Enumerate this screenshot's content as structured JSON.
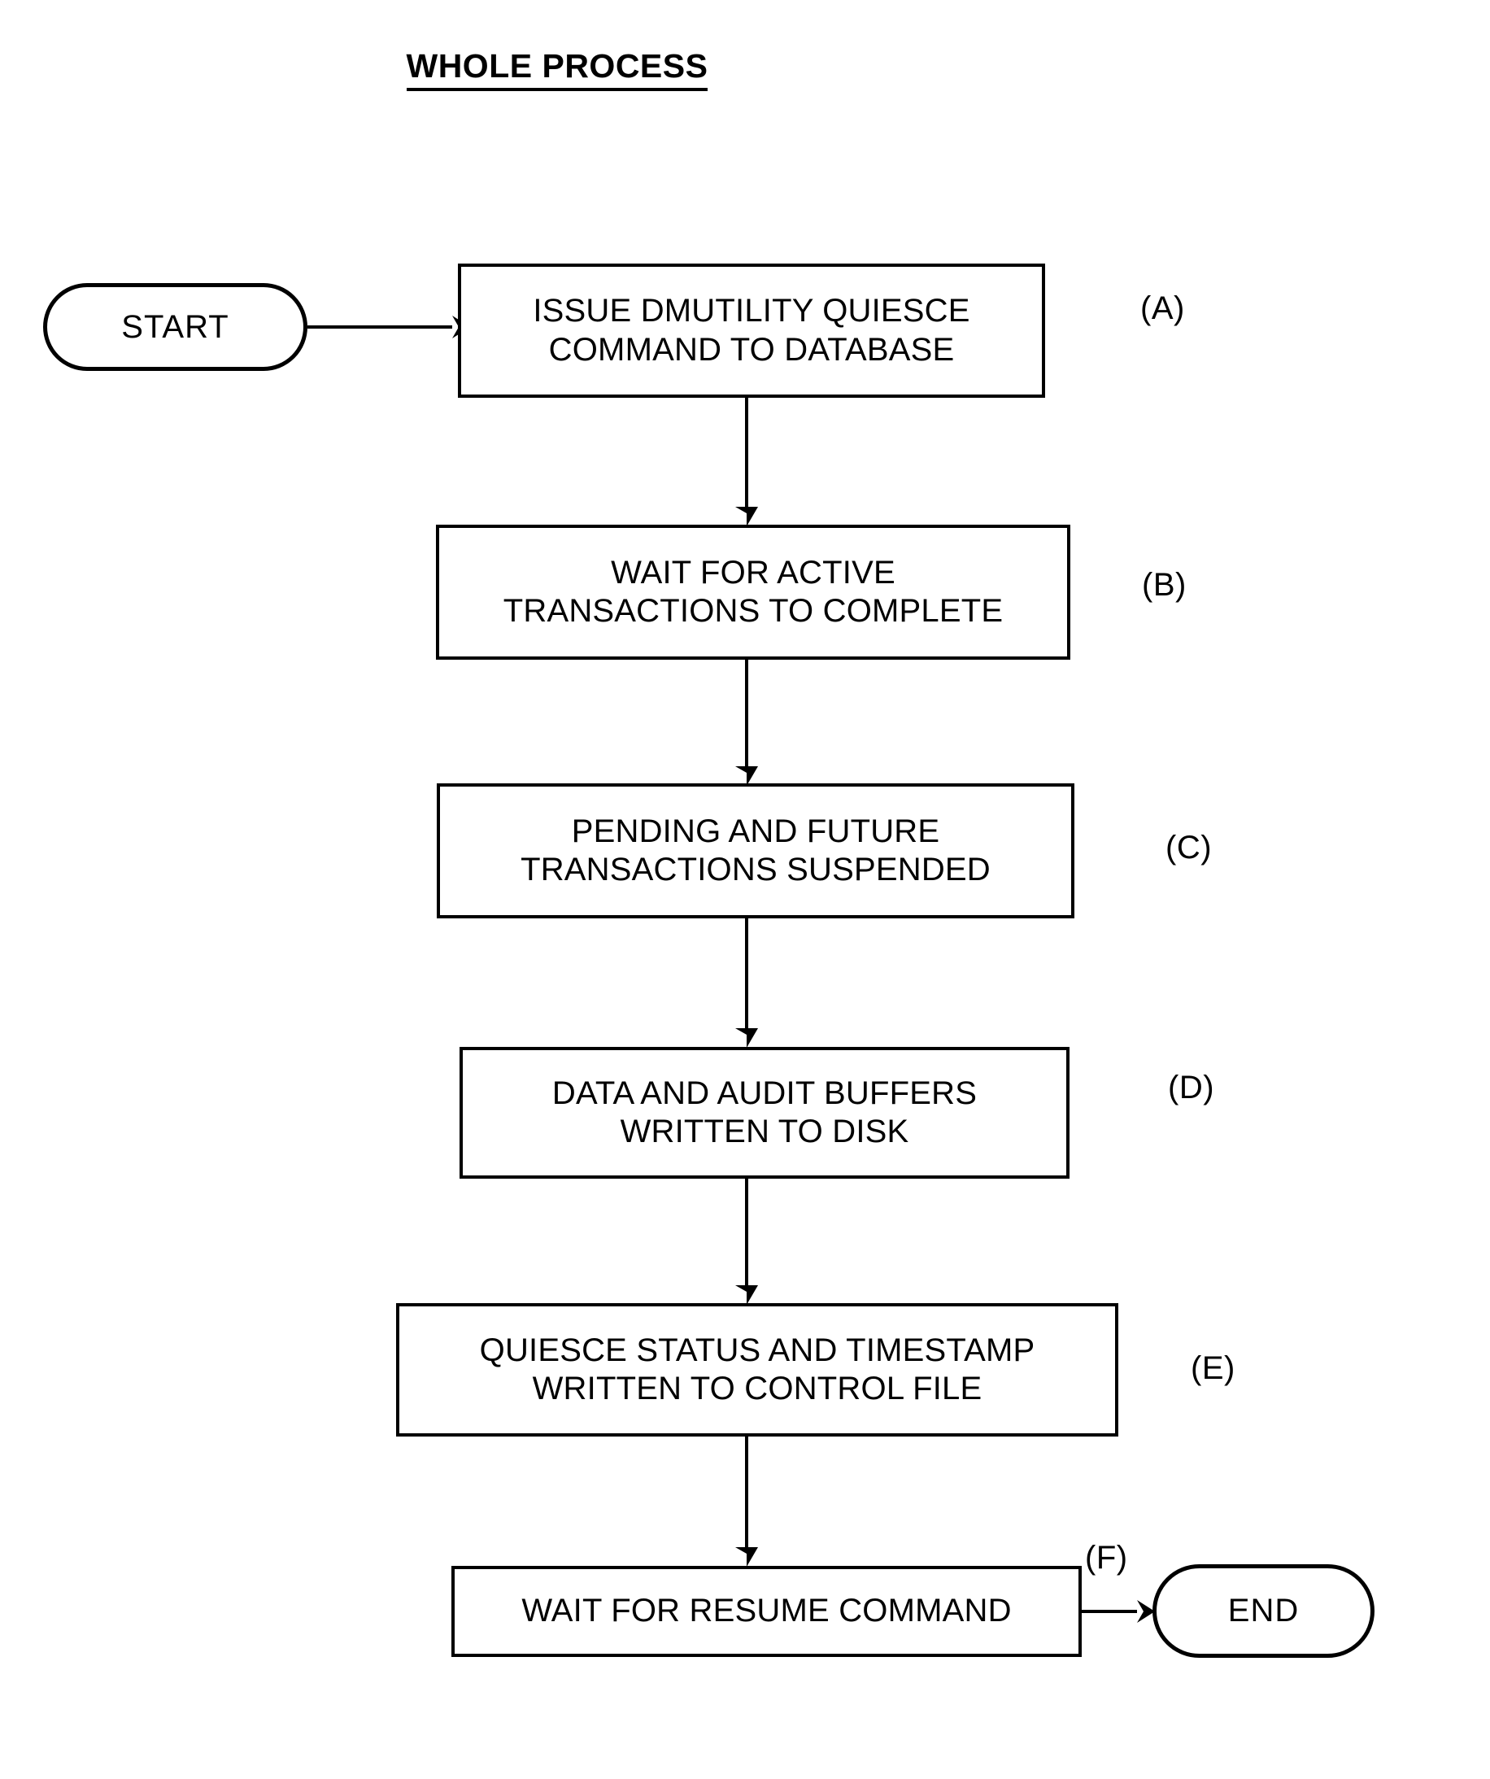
{
  "title": "WHOLE PROCESS",
  "nodes": {
    "start": {
      "label": "START"
    },
    "end": {
      "label": "END"
    }
  },
  "steps": [
    {
      "id": "A",
      "tag": "(A)",
      "lines": [
        "ISSUE DMUTILITY QUIESCE",
        "COMMAND TO DATABASE"
      ]
    },
    {
      "id": "B",
      "tag": "(B)",
      "lines": [
        "WAIT FOR ACTIVE",
        "TRANSACTIONS TO COMPLETE"
      ]
    },
    {
      "id": "C",
      "tag": "(C)",
      "lines": [
        "PENDING AND FUTURE",
        "TRANSACTIONS SUSPENDED"
      ]
    },
    {
      "id": "D",
      "tag": "(D)",
      "lines": [
        "DATA AND AUDIT BUFFERS",
        "WRITTEN TO DISK"
      ]
    },
    {
      "id": "E",
      "tag": "(E)",
      "lines": [
        "QUIESCE STATUS AND TIMESTAMP",
        "WRITTEN TO CONTROL FILE"
      ]
    },
    {
      "id": "F",
      "tag": "(F)",
      "lines": [
        "WAIT FOR RESUME COMMAND"
      ]
    }
  ],
  "colors": {
    "ink": "#000000",
    "paper": "#ffffff"
  }
}
